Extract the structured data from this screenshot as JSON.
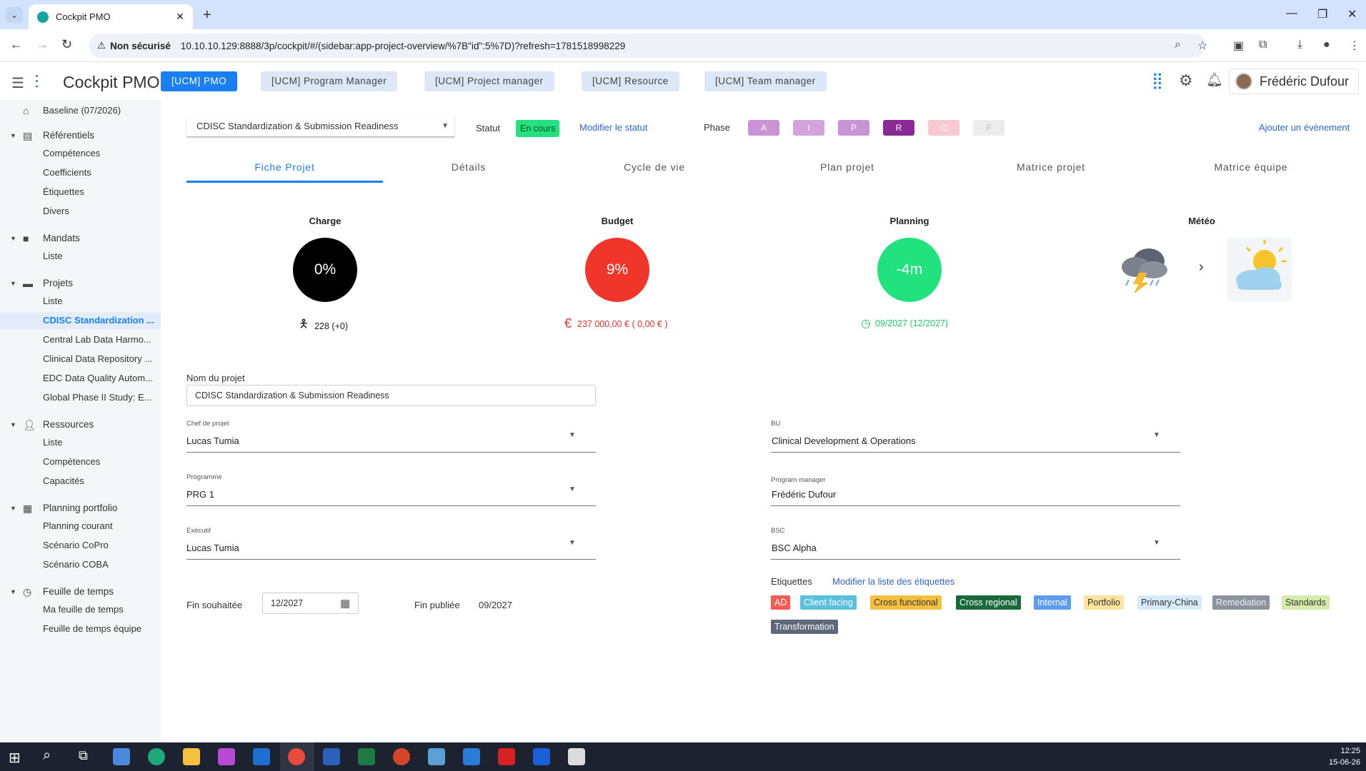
{
  "browser": {
    "tab_title": "Cockpit PMO",
    "new_tab": "+",
    "security_label": "Non sécurisé",
    "url": "10.10.10.129:8888/3p/cockpit/#/(sidebar:app-project-overview/%7B\"id\":5%7D)?refresh=1781518998229"
  },
  "header": {
    "app_title": "Cockpit PMO",
    "roles": [
      "[UCM] PMO",
      "[UCM] Program Manager",
      "[UCM] Project manager",
      "[UCM] Resource",
      "[UCM] Team manager"
    ],
    "user_name": "Frédéric Dufour"
  },
  "sidebar": {
    "baseline": "Baseline (07/2026)",
    "sections": [
      {
        "label": "Référentiels",
        "items": [
          "Compétences",
          "Coefficients",
          "Étiquettes",
          "Divers"
        ]
      },
      {
        "label": "Mandats",
        "items": [
          "Liste"
        ]
      },
      {
        "label": "Projets",
        "items": [
          "Liste",
          "CDISC Standardization ...",
          "Central Lab Data Harmo...",
          "Clinical Data Repository ...",
          "EDC Data Quality Autom...",
          "Global Phase II Study: E..."
        ]
      },
      {
        "label": "Ressources",
        "items": [
          "Liste",
          "Compétences",
          "Capacités"
        ]
      },
      {
        "label": "Planning portfolio",
        "items": [
          "Planning courant",
          "Scénario CoPro",
          "Scénario COBA"
        ]
      },
      {
        "label": "Feuille de temps",
        "items": [
          "Ma feuille de temps",
          "Feuille de temps équipe"
        ]
      }
    ]
  },
  "project": {
    "selector": "CDISC Standardization & Submission Readiness",
    "statut_label": "Statut",
    "statut_value": "En cours",
    "modify_status": "Modifier le statut",
    "phase_label": "Phase",
    "phases": [
      "A",
      "I",
      "P",
      "R",
      "C",
      "F"
    ],
    "add_event": "Ajouter un évènement"
  },
  "tabs": [
    "Fiche Projet",
    "Détails",
    "Cycle de vie",
    "Plan projet",
    "Matrice projet",
    "Matrice équipe"
  ],
  "kpis": {
    "charge": {
      "title": "Charge",
      "value": "0%",
      "sub": "228 (+0)",
      "color": "#000000"
    },
    "budget": {
      "title": "Budget",
      "value": "9%",
      "sub": "237 000,00 € ( 0,00 € )",
      "color": "#f0352a"
    },
    "planning": {
      "title": "Planning",
      "value": "-4m",
      "sub": "09/2027 (12/2027)",
      "color": "#22e27f"
    },
    "meteo": {
      "title": "Météo"
    }
  },
  "form": {
    "nom_label": "Nom du projet",
    "nom_value": "CDISC Standardization & Submission Readiness",
    "chef_label": "Chef de projet",
    "chef_value": "Lucas Tumia",
    "bu_label": "BU",
    "bu_value": "Clinical Development & Operations",
    "programme_label": "Programme",
    "programme_value": "PRG 1",
    "pm_label": "Program manager",
    "pm_value": "Frédéric Dufour",
    "executif_label": "Exécutif",
    "executif_value": "Lucas Tumia",
    "bsc_label": "BSC",
    "bsc_value": "BSC Alpha",
    "fin_souhaitee_label": "Fin souhaitée",
    "fin_souhaitee_value": "12/2027",
    "fin_publiee_label": "Fin publiée",
    "fin_publiee_value": "09/2027",
    "etiquettes_label": "Etiquettes",
    "modify_tags": "Modifier la liste des étiquettes",
    "tags": [
      "AD",
      "Client facing",
      "Cross functional",
      "Cross regional",
      "Internal",
      "Portfolio",
      "Primary-China",
      "Remediation",
      "Standards",
      "Transformation"
    ]
  },
  "taskbar": {
    "time": "12:25",
    "date": "15-06-26"
  }
}
